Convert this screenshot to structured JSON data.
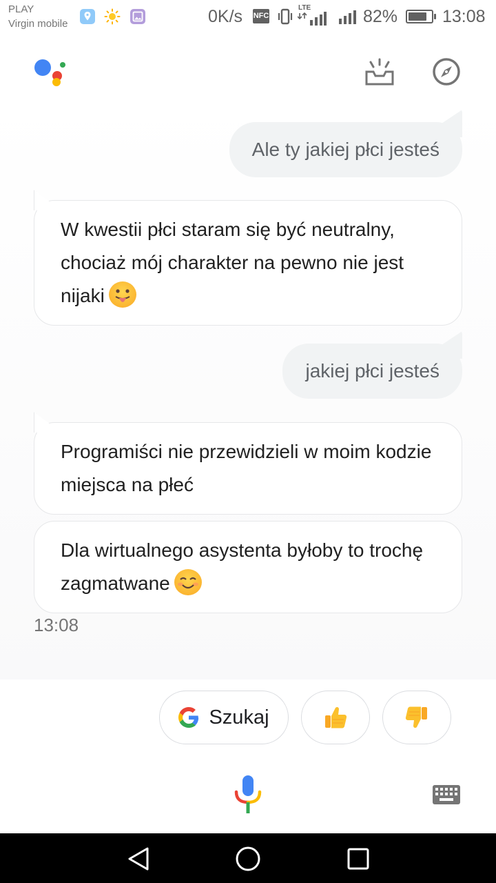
{
  "status_bar": {
    "carrier_1": "PLAY",
    "carrier_2": "Virgin mobile",
    "net_speed": "0K/s",
    "nfc": "NFC",
    "lte": "LTE",
    "battery_percent": "82%",
    "battery_level": 0.82,
    "time": "13:08"
  },
  "conversation": [
    {
      "role": "user",
      "text": "Ale ty jakiej płci jesteś"
    },
    {
      "role": "assistant",
      "text": "W kwestii płci staram się być neutralny, chociaż mój charakter na pewno nie jest nijaki",
      "emoji": "tongue-out-face"
    },
    {
      "role": "user",
      "text": "jakiej płci jesteś"
    },
    {
      "role": "assistant",
      "text": "Programiści nie przewidzieli w moim kodzie miejsca na płeć"
    },
    {
      "role": "assistant",
      "text": "Dla wirtualnego asystenta byłoby to trochę zagmatwane",
      "emoji": "smiling-face"
    }
  ],
  "timestamp": "13:08",
  "chips": {
    "search_label": "Szukaj",
    "thumbs_up_icon": "thumbs-up-icon",
    "thumbs_down_icon": "thumbs-down-icon"
  },
  "colors": {
    "google_blue": "#4285F4",
    "google_red": "#EA4335",
    "google_yellow": "#FBBC05",
    "google_green": "#34A853",
    "user_bubble": "#f1f3f4",
    "bot_border": "#e6e7e9"
  }
}
